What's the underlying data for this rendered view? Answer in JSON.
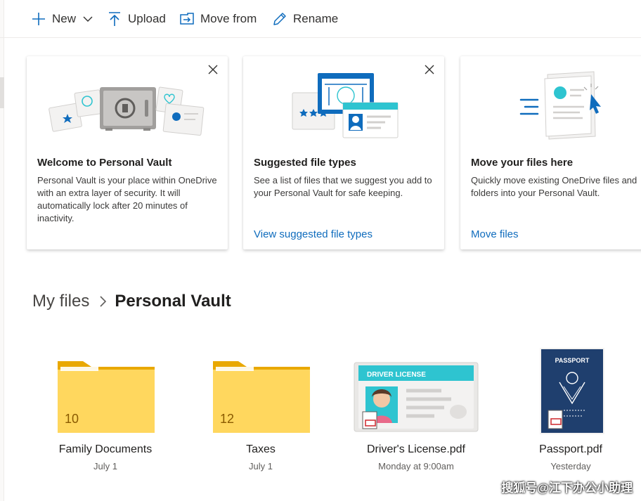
{
  "toolbar": {
    "new_label": "New",
    "upload_label": "Upload",
    "move_from_label": "Move from",
    "rename_label": "Rename"
  },
  "cards": [
    {
      "title": "Welcome to Personal Vault",
      "body": "Personal Vault is your place within OneDrive with an extra layer of security. It will automatically lock after 20 minutes of inactivity.",
      "link": ""
    },
    {
      "title": "Suggested file types",
      "body": "See a list of files that we suggest you add to your Personal Vault for safe keeping.",
      "link": "View suggested file types"
    },
    {
      "title": "Move your files here",
      "body": "Quickly move existing OneDrive files and folders into your Personal Vault.",
      "link": "Move files"
    }
  ],
  "breadcrumb": {
    "root": "My files",
    "current": "Personal Vault"
  },
  "items": [
    {
      "name": "Family Documents",
      "date": "July 1",
      "type": "folder",
      "count": "10"
    },
    {
      "name": "Taxes",
      "date": "July 1",
      "type": "folder",
      "count": "12"
    },
    {
      "name": "Driver's License.pdf",
      "date": "Monday at 9:00am",
      "type": "pdf",
      "thumb_text": "DRIVER LICENSE"
    },
    {
      "name": "Passport.pdf",
      "date": "Yesterday",
      "type": "pdf",
      "thumb_text": "PASSPORT"
    }
  ],
  "watermark": "搜狐号@江下办公小助理",
  "colors": {
    "accent": "#0f6cbd",
    "folder": "#ffd75e",
    "passport": "#1f3f6e",
    "license_header": "#2ec4d0"
  }
}
